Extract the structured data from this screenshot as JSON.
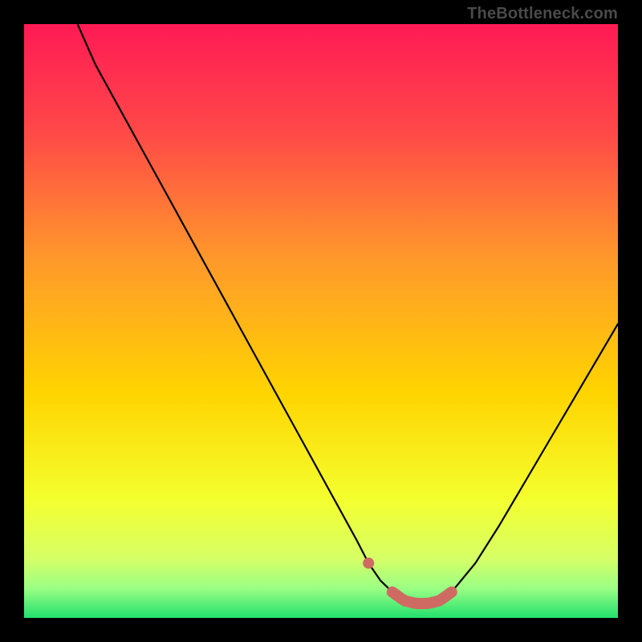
{
  "watermark": "TheBottleneck.com",
  "colors": {
    "frame": "#000000",
    "curve": "#000000",
    "marker": "#cf6a63",
    "gradient_stops": [
      {
        "offset": 0.0,
        "color": "#ff1a55"
      },
      {
        "offset": 0.18,
        "color": "#ff4848"
      },
      {
        "offset": 0.4,
        "color": "#ff9a2a"
      },
      {
        "offset": 0.62,
        "color": "#ffd400"
      },
      {
        "offset": 0.8,
        "color": "#f4ff2e"
      },
      {
        "offset": 0.9,
        "color": "#d6ff66"
      },
      {
        "offset": 0.95,
        "color": "#9bff84"
      },
      {
        "offset": 1.0,
        "color": "#22e06e"
      }
    ]
  },
  "chart_data": {
    "type": "line",
    "title": "",
    "xlabel": "",
    "ylabel": "",
    "xlim": [
      0,
      100
    ],
    "ylim": [
      0,
      103
    ],
    "series": [
      {
        "name": "curve",
        "x": [
          9,
          12,
          16,
          20,
          24,
          28,
          32,
          36,
          40,
          44,
          48,
          52,
          56,
          58,
          60,
          62,
          64,
          66,
          68,
          70,
          72,
          76,
          80,
          84,
          88,
          92,
          96,
          100
        ],
        "y": [
          103,
          96,
          88.5,
          81,
          73.5,
          66,
          58.5,
          51,
          43.5,
          36,
          28.5,
          21,
          13.5,
          9.5,
          6.5,
          4.5,
          3,
          2.5,
          2.5,
          3,
          4.5,
          9.5,
          16,
          23,
          30,
          37,
          44,
          51
        ]
      }
    ],
    "highlight": {
      "dot_x": 58,
      "segment_x": [
        62,
        72
      ]
    }
  }
}
